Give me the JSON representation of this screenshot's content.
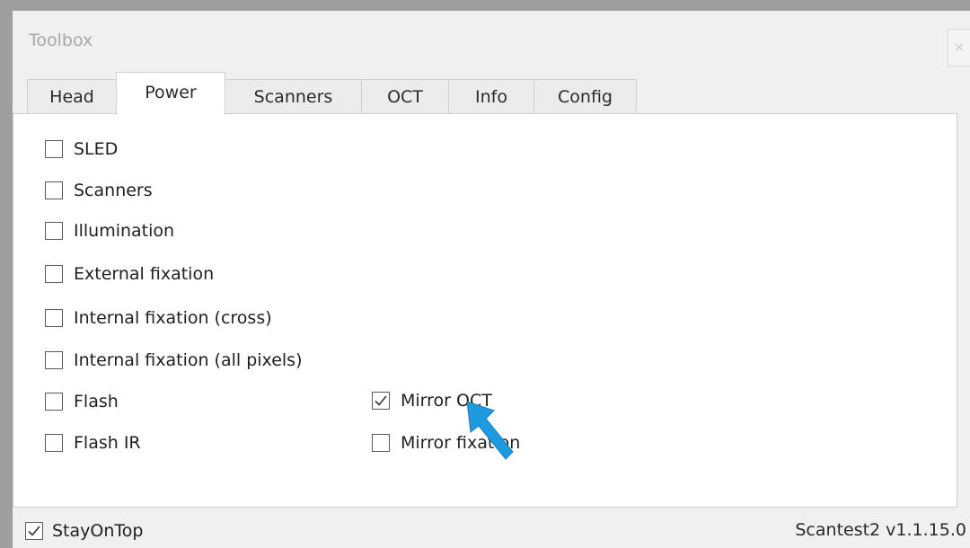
{
  "window": {
    "title": "Toolbox",
    "close_label": "×"
  },
  "tabs": [
    {
      "label": "Head",
      "active": false
    },
    {
      "label": "Power",
      "active": true
    },
    {
      "label": "Scanners",
      "active": false
    },
    {
      "label": "OCT",
      "active": false
    },
    {
      "label": "Info",
      "active": false
    },
    {
      "label": "Config",
      "active": false
    }
  ],
  "power": {
    "checkboxes": [
      {
        "label": "SLED",
        "checked": false
      },
      {
        "label": "Scanners",
        "checked": false
      },
      {
        "label": "Illumination",
        "checked": false
      },
      {
        "label": "External fixation",
        "checked": false
      },
      {
        "label": "Internal fixation (cross)",
        "checked": false
      },
      {
        "label": "Internal fixation (all pixels)",
        "checked": false
      },
      {
        "label": "Flash",
        "checked": false
      },
      {
        "label": "Flash IR",
        "checked": false
      },
      {
        "label": "Mirror OCT",
        "checked": true
      },
      {
        "label": "Mirror fixation",
        "checked": false
      }
    ]
  },
  "footer": {
    "stay_on_top": {
      "label": "StayOnTop",
      "checked": true
    },
    "version": "Scantest2 v1.1.15.0"
  },
  "colors": {
    "cursor": "#1e9be0",
    "window_bg": "#f0f0f0",
    "frame": "#9e9e9e"
  },
  "icons": {
    "cursor": "arrow-cursor-icon"
  }
}
